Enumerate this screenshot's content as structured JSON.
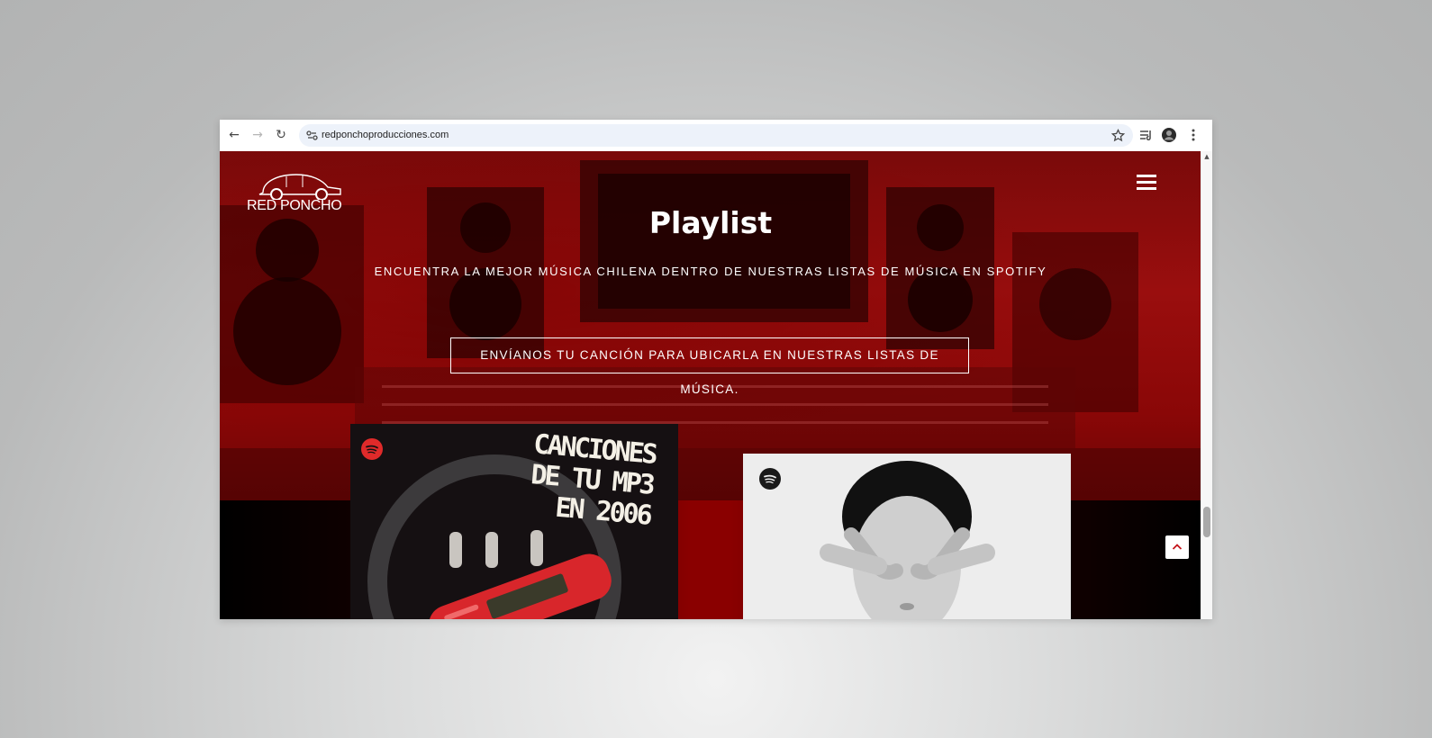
{
  "browser": {
    "url": "redponchoproducciones.com",
    "nav": {
      "back": "←",
      "forward": "→",
      "reload": "↻"
    }
  },
  "header": {
    "logo_text": "RED PONCHO"
  },
  "hero": {
    "title": "Playlist",
    "subtitle": "ENCUENTRA LA MEJOR MÚSICA CHILENA DENTRO DE NUESTRAS LISTAS DE MÚSICA EN SPOTIFY",
    "cta_label": "ENVÍANOS TU CANCIÓN PARA UBICARLA EN NUESTRAS LISTAS DE MÚSICA."
  },
  "playlists": [
    {
      "cover_lines": [
        "CANCIONES",
        "DE TU MP3",
        "EN 2006"
      ],
      "badge_color": "#e02a2a"
    },
    {
      "cover_lines": [],
      "badge_color": "#1a1a1a"
    }
  ],
  "colors": {
    "brand_red": "#9a0e0e",
    "spotify_badge_red": "#e02a2a",
    "omnibox": "#edf2fa"
  },
  "icons": [
    "back-icon",
    "forward-icon",
    "reload-icon",
    "site-info-icon",
    "bookmark-star-icon",
    "media-controls-icon",
    "profile-avatar-icon",
    "more-menu-icon",
    "hamburger-menu-icon",
    "spotify-icon",
    "chevron-up-icon"
  ]
}
